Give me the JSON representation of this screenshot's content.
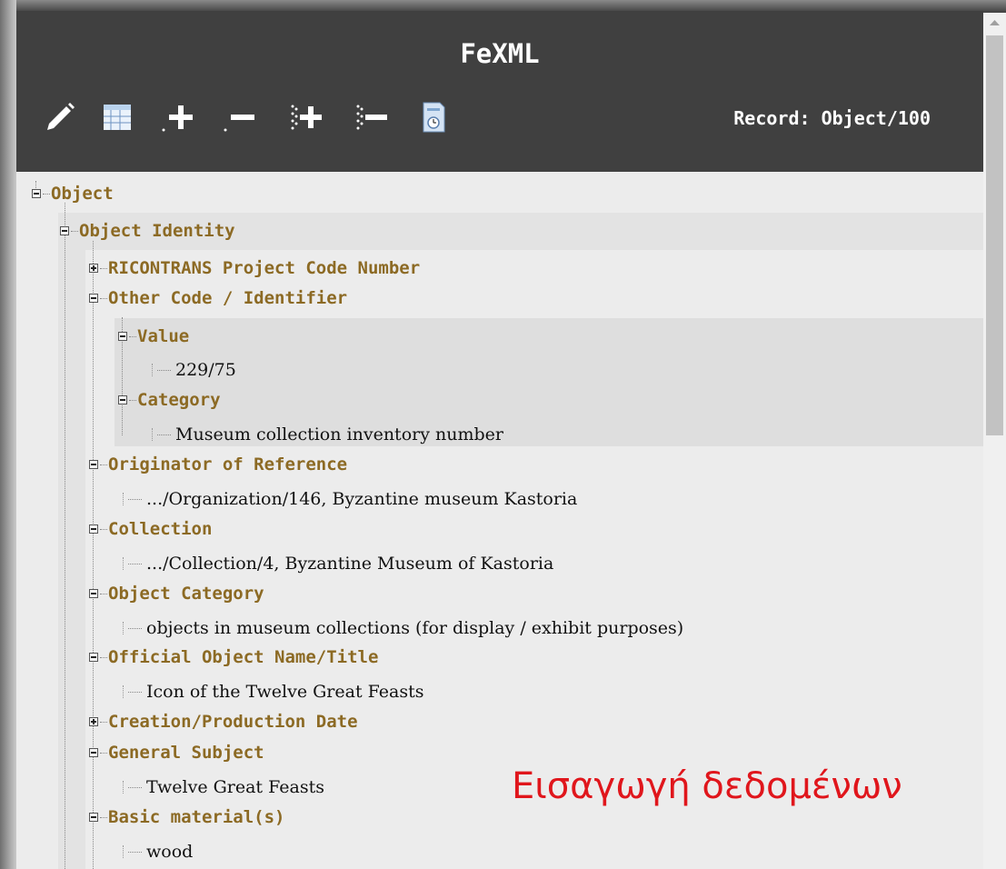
{
  "app": {
    "title": "FeXML",
    "record": "Record: Object/100"
  },
  "toolbar": {
    "buttons": [
      {
        "name": "edit-icon"
      },
      {
        "name": "table-view-icon"
      },
      {
        "name": "add-element-icon"
      },
      {
        "name": "remove-element-icon"
      },
      {
        "name": "add-children-icon"
      },
      {
        "name": "remove-children-icon"
      },
      {
        "name": "calendar-document-icon"
      }
    ]
  },
  "tree": {
    "root": "Object",
    "group": "Object Identity",
    "fields": [
      {
        "label": "RICONTRANS Project Code Number",
        "state": "collapsed"
      },
      {
        "label": "Other Code / Identifier",
        "state": "expanded",
        "children": [
          {
            "label": "Value",
            "value": "229/75"
          },
          {
            "label": "Category",
            "value": "Museum collection inventory number"
          }
        ]
      },
      {
        "label": "Originator of Reference",
        "value": ".../Organization/146, Byzantine museum Kastoria"
      },
      {
        "label": "Collection",
        "value": ".../Collection/4, Byzantine Museum of Kastoria"
      },
      {
        "label": "Object Category",
        "value": "objects in museum collections (for display / exhibit purposes)"
      },
      {
        "label": "Official Object Name/Title",
        "value": "Icon of the Twelve Great Feasts"
      },
      {
        "label": "Creation/Production Date",
        "state": "collapsed"
      },
      {
        "label": "General Subject",
        "value": "Twelve Great Feasts"
      },
      {
        "label": "Basic material(s)",
        "value": "wood"
      }
    ]
  },
  "overlay_text": "Εισαγωγή δεδομένων",
  "colors": {
    "header_bg": "#404040",
    "label": "#8c6a24",
    "overlay": "#e0161c"
  }
}
